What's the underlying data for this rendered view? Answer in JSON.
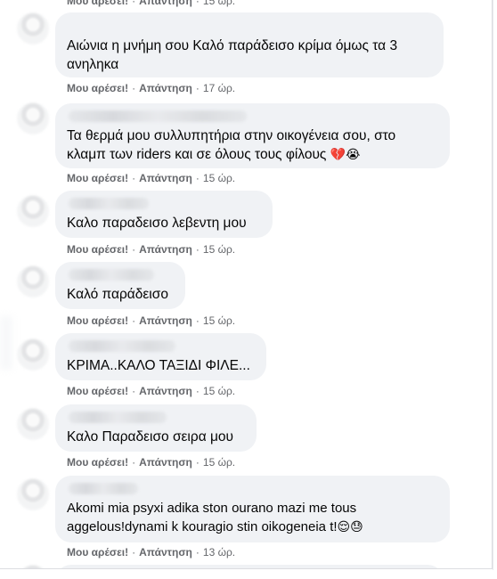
{
  "top": {
    "like": "Μου αρέσει!",
    "reply": "Απάντηση",
    "time": "15 ώρ."
  },
  "comments": [
    {
      "text": "Αιώνια η μνήμη σου Καλό παράδεισο κρίμα όμως τα 3 ανηληκα",
      "like": "Μου αρέσει!",
      "reply": "Απάντηση",
      "time": "17 ώρ.",
      "emoji": ""
    },
    {
      "text": "Τα θερμά μου συλλυπητήρια στην οικογένεια σου, στο κλαμπ των riders και σε όλους τους φίλους",
      "like": "Μου αρέσει!",
      "reply": "Απάντηση",
      "time": "15 ώρ.",
      "emoji": "💔😭"
    },
    {
      "text": "Καλο παραδεισο λεβεντη μου",
      "like": "Μου αρέσει!",
      "reply": "Απάντηση",
      "time": "15 ώρ.",
      "emoji": ""
    },
    {
      "text": "Καλό παράδεισο",
      "like": "Μου αρέσει!",
      "reply": "Απάντηση",
      "time": "15 ώρ.",
      "emoji": ""
    },
    {
      "text": "ΚΡΙΜΑ..ΚΑΛΟ ΤΑΞΙΔΙ ΦΙΛΕ...",
      "like": "Μου αρέσει!",
      "reply": "Απάντηση",
      "time": "15 ώρ.",
      "emoji": ""
    },
    {
      "text": "Καλο Παραδεισο σειρα μου",
      "like": "Μου αρέσει!",
      "reply": "Απάντηση",
      "time": "15 ώρ.",
      "emoji": ""
    },
    {
      "text": "Akomi mia psyxi adika ston ourano mazi me tous aggelous!dynami k kouragio stin oikogeneia t!",
      "like": "Μου αρέσει!",
      "reply": "Απάντηση",
      "time": "13 ώρ.",
      "emoji": "😌😓"
    }
  ]
}
